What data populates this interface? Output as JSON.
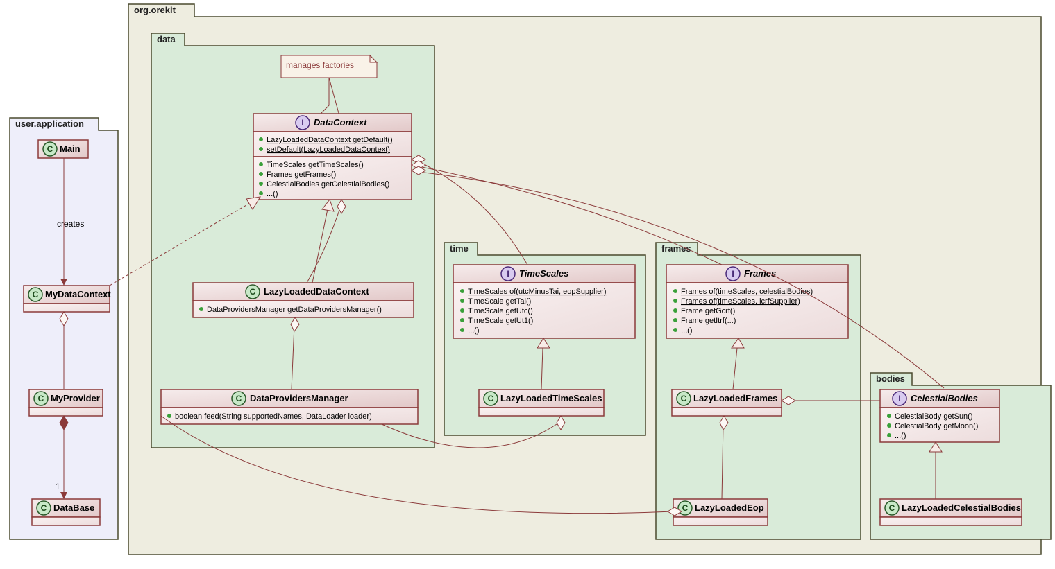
{
  "packages": {
    "main": "org.orekit",
    "user": "user.application",
    "data": "data",
    "time": "time",
    "frames": "frames",
    "bodies": "bodies"
  },
  "note": "manages factories",
  "user_app": {
    "Main": "Main",
    "MyDataContext": "MyDataContext",
    "MyProvider": "MyProvider",
    "DataBase": "DataBase"
  },
  "data_pkg": {
    "DataContext": {
      "name": "DataContext",
      "m1": "LazyLoadedDataContext getDefault()",
      "m2": "setDefault(LazyLoadedDataContext)",
      "m3": "TimeScales getTimeScales()",
      "m4": "Frames getFrames()",
      "m5": "CelestialBodies getCelestialBodies()",
      "m6": "...()"
    },
    "LazyLoadedDataContext": {
      "name": "LazyLoadedDataContext",
      "m1": "DataProvidersManager getDataProvidersManager()"
    },
    "DataProvidersManager": {
      "name": "DataProvidersManager",
      "m1": "boolean feed(String supportedNames, DataLoader loader)"
    }
  },
  "time_pkg": {
    "TimeScales": {
      "name": "TimeScales",
      "m1": "TimeScales of(utcMinusTai, eopSupplier)",
      "m2": "TimeScale getTai()",
      "m3": "TimeScale getUtc()",
      "m4": "TimeScale getUt1()",
      "m5": "...()"
    },
    "LazyLoadedTimeScales": "LazyLoadedTimeScales"
  },
  "frames_pkg": {
    "Frames": {
      "name": "Frames",
      "m1": "Frames of(timeScales, celestialBodies)",
      "m2": "Frames of(timeScales, icrfSupplier)",
      "m3": "Frame getGcrf()",
      "m4": "Frame getItrf(...)",
      "m5": "...()"
    },
    "LazyLoadedFrames": "LazyLoadedFrames",
    "LazyLoadedEop": "LazyLoadedEop"
  },
  "bodies_pkg": {
    "CelestialBodies": {
      "name": "CelestialBodies",
      "m1": "CelestialBody getSun()",
      "m2": "CelestialBody getMoon()",
      "m3": "...()"
    },
    "LazyLoadedCelestialBodies": "LazyLoadedCelestialBodies"
  },
  "labels": {
    "creates": "creates",
    "one": "1"
  }
}
